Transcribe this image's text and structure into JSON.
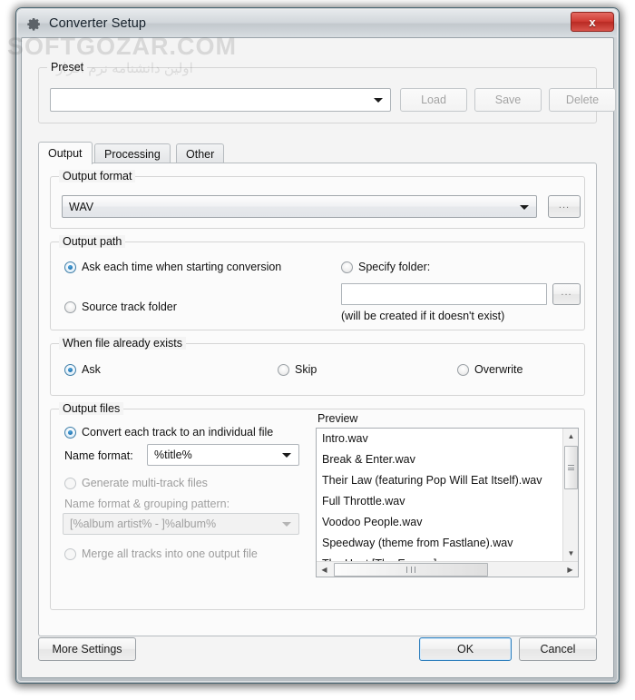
{
  "window": {
    "title": "Converter Setup",
    "title_icon": "gear-icon",
    "close_label": "x",
    "accent_default_button": "#2f7fbd",
    "close_button_color": "#cf3b33"
  },
  "watermark": {
    "line1": "SOFTGOZAR.COM",
    "line2": "اولین دانشنامه نرم افزار"
  },
  "preset": {
    "legend": "Preset",
    "combo_value": "",
    "load_label": "Load",
    "save_label": "Save",
    "delete_label": "Delete"
  },
  "tabs": [
    {
      "label": "Output",
      "active": true
    },
    {
      "label": "Processing",
      "active": false
    },
    {
      "label": "Other",
      "active": false
    }
  ],
  "output_format": {
    "legend": "Output format",
    "value": "WAV",
    "browse_label": "..."
  },
  "output_path": {
    "legend": "Output path",
    "options": [
      {
        "label": "Ask each time when starting conversion",
        "checked": true
      },
      {
        "label": "Source track folder",
        "checked": false
      },
      {
        "label": "Specify folder:",
        "checked": false
      }
    ],
    "folder_value": "",
    "browse_label": "...",
    "hint": "(will be created if it doesn't exist)"
  },
  "file_exists": {
    "legend": "When file already exists",
    "options": [
      {
        "label": "Ask",
        "checked": true
      },
      {
        "label": "Skip",
        "checked": false
      },
      {
        "label": "Overwrite",
        "checked": false
      }
    ]
  },
  "output_files": {
    "legend": "Output files",
    "individual": {
      "radio_label": "Convert each track to an individual file",
      "checked": true,
      "name_format_label": "Name format:",
      "name_format_value": "%title%"
    },
    "multitrack": {
      "radio_label": "Generate multi-track files",
      "checked": false,
      "pattern_label": "Name format & grouping pattern:",
      "pattern_value": "[%album artist% - ]%album%"
    },
    "merge": {
      "radio_label": "Merge all tracks into one output file",
      "checked": false
    },
    "preview": {
      "legend": "Preview",
      "items": [
        "Intro.wav",
        "Break & Enter.wav",
        "Their Law (featuring Pop Will Eat Itself).wav",
        "Full Throttle.wav",
        "Voodoo People.wav",
        "Speedway (theme from Fastlane).wav",
        "The Heat [The Energy].wav"
      ]
    }
  },
  "footer": {
    "more_settings_label": "More Settings",
    "ok_label": "OK",
    "cancel_label": "Cancel"
  }
}
